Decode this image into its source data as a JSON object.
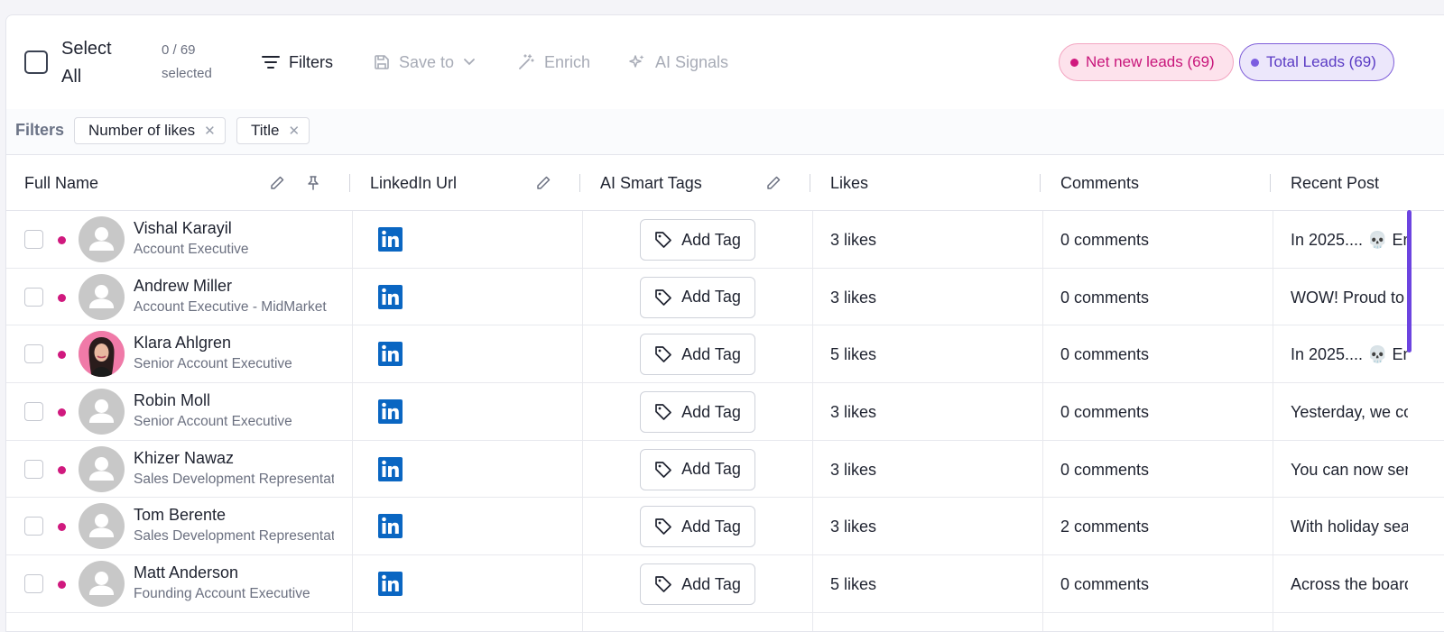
{
  "toolbar": {
    "select_all_label": "Select All",
    "selected_count": "0 / 69 selected",
    "filters_label": "Filters",
    "save_to_label": "Save to",
    "enrich_label": "Enrich",
    "ai_signals_label": "AI Signals"
  },
  "pills": {
    "net_new": "Net new leads (69)",
    "total": "Total Leads (69)"
  },
  "filters": {
    "label": "Filters",
    "chips": [
      "Number of likes",
      "Title"
    ]
  },
  "columns": [
    "Full Name",
    "LinkedIn Url",
    "AI Smart Tags",
    "Likes",
    "Comments",
    "Recent Post"
  ],
  "add_tag_label": "Add Tag",
  "rows": [
    {
      "name": "Vishal Karayil",
      "title": "Account Executive",
      "likes": "3 likes",
      "comments": "0 comments",
      "recent_post": "In 2025.... 💀 Em",
      "has_photo": false
    },
    {
      "name": "Andrew Miller",
      "title": "Account Executive - MidMarket",
      "likes": "3 likes",
      "comments": "0 comments",
      "recent_post": "WOW! Proud to",
      "has_photo": false
    },
    {
      "name": "Klara Ahlgren",
      "title": "Senior Account Executive",
      "likes": "5 likes",
      "comments": "0 comments",
      "recent_post": "In 2025.... 💀 Em",
      "has_photo": true
    },
    {
      "name": "Robin Moll",
      "title": "Senior Account Executive",
      "likes": "3 likes",
      "comments": "0 comments",
      "recent_post": "Yesterday, we co",
      "has_photo": false
    },
    {
      "name": "Khizer Nawaz",
      "title": "Sales Development Representative",
      "likes": "3 likes",
      "comments": "0 comments",
      "recent_post": "You can now sen",
      "has_photo": false
    },
    {
      "name": "Tom Berente",
      "title": "Sales Development Representative",
      "likes": "3 likes",
      "comments": "2 comments",
      "recent_post": "With holiday sea",
      "has_photo": false
    },
    {
      "name": "Matt Anderson",
      "title": "Founding Account Executive",
      "likes": "5 likes",
      "comments": "0 comments",
      "recent_post": "Across the board",
      "has_photo": false
    }
  ],
  "colors": {
    "accent_pink": "#d0197e",
    "accent_purple": "#6c44e0",
    "linkedin_blue": "#0a66c2"
  }
}
